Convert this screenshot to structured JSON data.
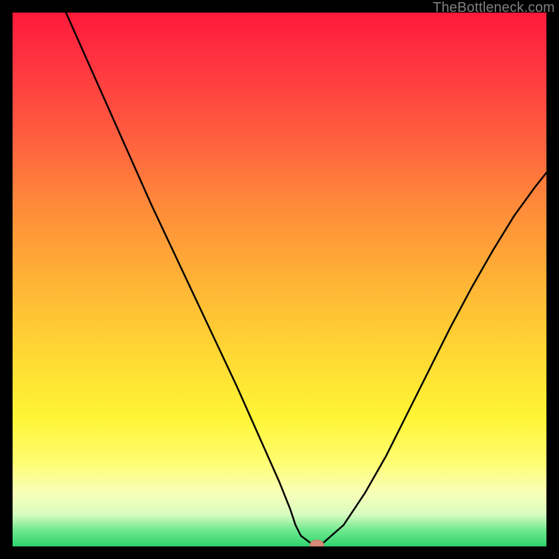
{
  "watermark": "TheBottleneck.com",
  "colors": {
    "frame": "#000000",
    "curve": "#000000",
    "marker_fill": "#d88a78",
    "marker_stroke": "#c07860",
    "gradient_top": "#ff1a3a",
    "gradient_bottom": "#2fd36d"
  },
  "chart_data": {
    "type": "line",
    "title": "",
    "xlabel": "",
    "ylabel": "",
    "xlim": [
      0,
      100
    ],
    "ylim": [
      0,
      100
    ],
    "axes_visible": false,
    "series": [
      {
        "name": "curve",
        "x": [
          10,
          14,
          18,
          22,
          26,
          30,
          34,
          38,
          42,
          46,
          48,
          50,
          52,
          53,
          54,
          56,
          58,
          62,
          66,
          70,
          74,
          78,
          82,
          86,
          90,
          94,
          98,
          100
        ],
        "y": [
          100,
          91,
          82,
          73,
          64,
          55.5,
          47,
          38.5,
          30,
          21,
          16.5,
          12,
          7,
          4,
          2,
          0.5,
          0.5,
          4,
          10,
          17,
          25,
          33,
          41,
          48.5,
          55.5,
          62,
          67.5,
          70
        ]
      }
    ],
    "marker": {
      "x": 57,
      "y": 0.3,
      "rx": 1.3,
      "ry": 0.9
    },
    "note": "y is percent-of-height from bottom; curve depicts a V-shaped bottleneck profile with minimum near x≈57."
  }
}
